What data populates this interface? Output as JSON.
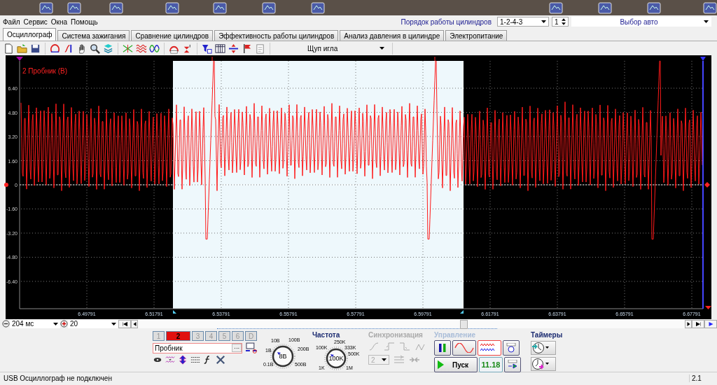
{
  "menu": [
    "Файл",
    "Сервис",
    "Окна",
    "Помощь"
  ],
  "cylinder_order": {
    "label": "Порядок работы цилиндров",
    "value": "1-2-4-3",
    "spin_value": "1"
  },
  "car_select": {
    "value": "Выбор авто"
  },
  "tabs": [
    {
      "label": "Осциллограф",
      "selected": true
    },
    {
      "label": "Система зажигания",
      "selected": false
    },
    {
      "label": "Сравнение цилиндров",
      "selected": false
    },
    {
      "label": "Эффективность работы цилиндров",
      "selected": false
    },
    {
      "label": "Анализ давления в цилиндре",
      "selected": false
    },
    {
      "label": "Электропитание",
      "selected": false
    }
  ],
  "toolbar": {
    "probe_select": "Щуп игла"
  },
  "plot": {
    "channel_label": "2 Пробник (В)",
    "y_ticks": [
      "6.40",
      "4.80",
      "3.20",
      "1.60",
      "0",
      "-1.60",
      "-3.20",
      "-4.80",
      "-6.40"
    ],
    "x_ticks": [
      "6.49791",
      "6.51791",
      "6.53791",
      "6.55791",
      "6.57791",
      "6.59791",
      "6.61791",
      "6.63791",
      "6.65791",
      "6.67791"
    ]
  },
  "timebase": {
    "span": "204 мс",
    "zoom": "20"
  },
  "channels": [
    {
      "label": "1",
      "selected": false
    },
    {
      "label": "2",
      "selected": true
    },
    {
      "label": "3",
      "selected": false
    },
    {
      "label": "4",
      "selected": false
    },
    {
      "label": "5",
      "selected": false
    },
    {
      "label": "6",
      "selected": false
    },
    {
      "label": "D",
      "selected": false
    }
  ],
  "probe_field": {
    "value": "Пробник",
    "browse": "···"
  },
  "voltage_knob": {
    "labels": [
      "10В",
      "100В",
      "1В",
      "200В",
      "0.1В",
      "500В"
    ],
    "value": "8В"
  },
  "frequency": {
    "title": "Частота",
    "labels": [
      "250K",
      "100K",
      "333K",
      "500K",
      "1K",
      "1M"
    ],
    "value": "100K"
  },
  "sync": {
    "title": "Синхронизация",
    "disabled": true,
    "channel": "2"
  },
  "control": {
    "title": "Управление",
    "start": "Пуск",
    "reading": "11.18"
  },
  "timers": {
    "title": "Таймеры"
  },
  "status_bar": {
    "message": "USB Осциллограф не подключен",
    "version": "2.1"
  }
}
